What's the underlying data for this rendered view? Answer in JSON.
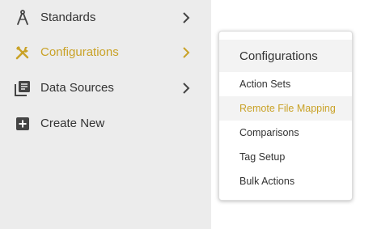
{
  "colors": {
    "accent": "#c9a227",
    "text": "#333333",
    "sidebar_bg": "#ececec",
    "hover_bg": "#f3f3f3"
  },
  "sidebar": {
    "items": [
      {
        "label": "Standards",
        "icon": "compass-icon",
        "has_submenu": true,
        "active": false
      },
      {
        "label": "Configurations",
        "icon": "tools-icon",
        "has_submenu": true,
        "active": true
      },
      {
        "label": "Data Sources",
        "icon": "library-icon",
        "has_submenu": true,
        "active": false
      },
      {
        "label": "Create New",
        "icon": "plus-box-icon",
        "has_submenu": false,
        "active": false
      }
    ]
  },
  "flyout": {
    "title": "Configurations",
    "items": [
      {
        "label": "Action Sets",
        "highlighted": false
      },
      {
        "label": "Remote File Mapping",
        "highlighted": true
      },
      {
        "label": "Comparisons",
        "highlighted": false
      },
      {
        "label": "Tag Setup",
        "highlighted": false
      },
      {
        "label": "Bulk Actions",
        "highlighted": false
      }
    ]
  }
}
